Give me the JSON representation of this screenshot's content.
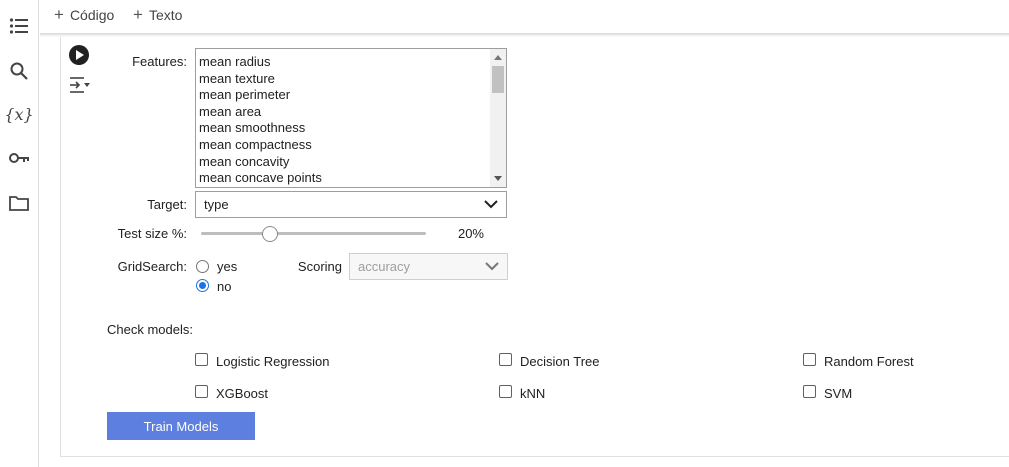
{
  "toolbar": {
    "code_label": "Código",
    "text_label": "Texto"
  },
  "sidebar": {
    "icons": [
      "toc-icon",
      "search-icon",
      "variables-icon",
      "key-icon",
      "folder-icon"
    ],
    "variables_glyph": "{x}"
  },
  "form": {
    "features": {
      "label": "Features:",
      "options": [
        "mean radius",
        "mean texture",
        "mean perimeter",
        "mean area",
        "mean smoothness",
        "mean compactness",
        "mean concavity",
        "mean concave points"
      ]
    },
    "target": {
      "label": "Target:",
      "value": "type"
    },
    "test_size": {
      "label": "Test size %:",
      "value": 20,
      "value_text": "20%",
      "min": 0,
      "max": 100
    },
    "gridsearch": {
      "label": "GridSearch:",
      "options": [
        "yes",
        "no"
      ],
      "selected": "no"
    },
    "scoring": {
      "label": "Scoring",
      "value": "accuracy",
      "disabled": true
    },
    "check_models": {
      "label": "Check models:",
      "models": [
        "Logistic Regression",
        "Decision Tree",
        "Random Forest",
        "XGBoost",
        "kNN",
        "SVM"
      ],
      "checked": [
        false,
        false,
        false,
        false,
        false,
        false
      ]
    },
    "train_button": "Train Models"
  },
  "colors": {
    "accent": "#1a73e8",
    "train_button": "#5c7fe0"
  }
}
